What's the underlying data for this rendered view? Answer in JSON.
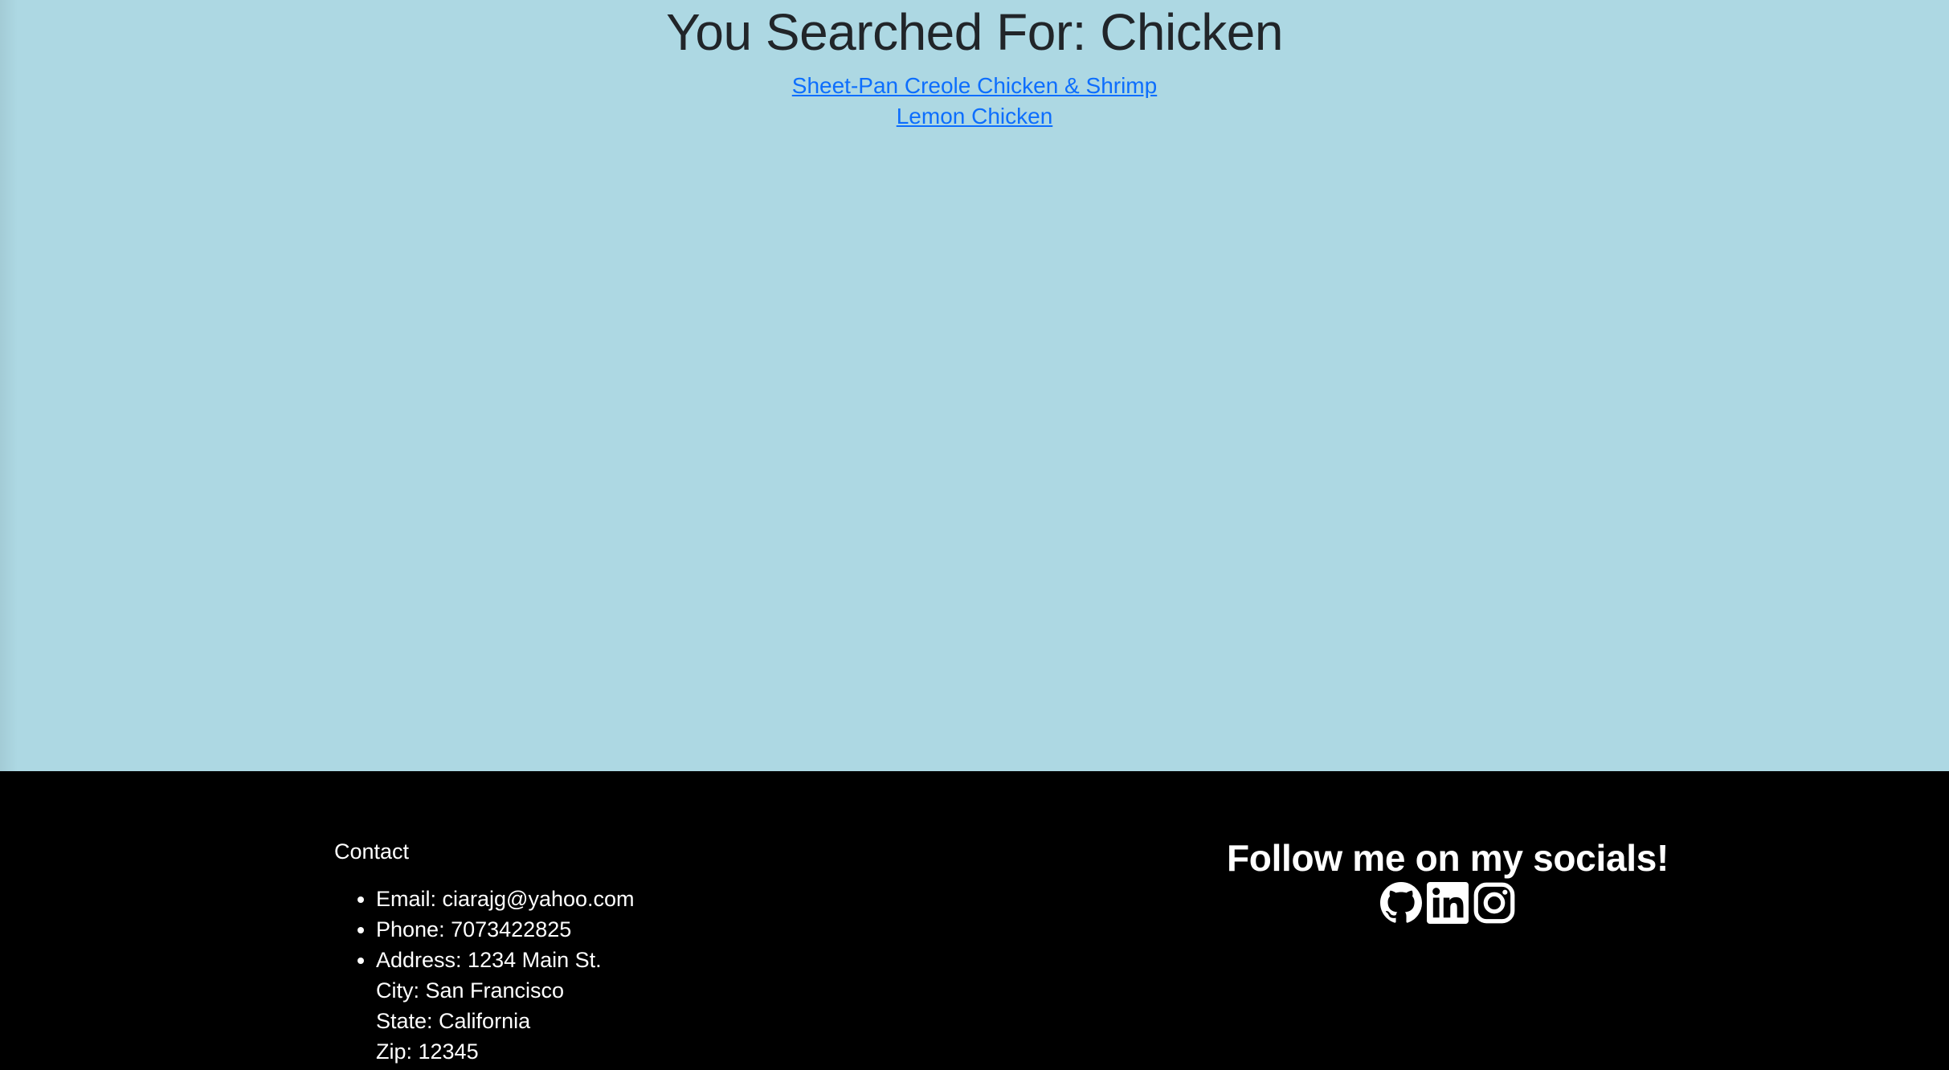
{
  "search": {
    "heading": "You Searched For: Chicken",
    "results": [
      {
        "label": "Sheet-Pan Creole Chicken & Shrimp"
      },
      {
        "label": "Lemon Chicken"
      }
    ]
  },
  "footer": {
    "contact": {
      "heading": "Contact",
      "email": "Email: ciarajg@yahoo.com",
      "phone": "Phone: 7073422825",
      "address": "Address: 1234 Main St.",
      "city": "City: San Francisco",
      "state": "State: California",
      "zip": "Zip: 12345"
    },
    "socials": {
      "heading": "Follow me on my socials!",
      "icons": [
        "github-icon",
        "linkedin-icon",
        "instagram-icon"
      ]
    }
  },
  "colors": {
    "background": "#add8e3",
    "footer": "#000000",
    "link": "#0d6efd",
    "heading": "#212529"
  }
}
